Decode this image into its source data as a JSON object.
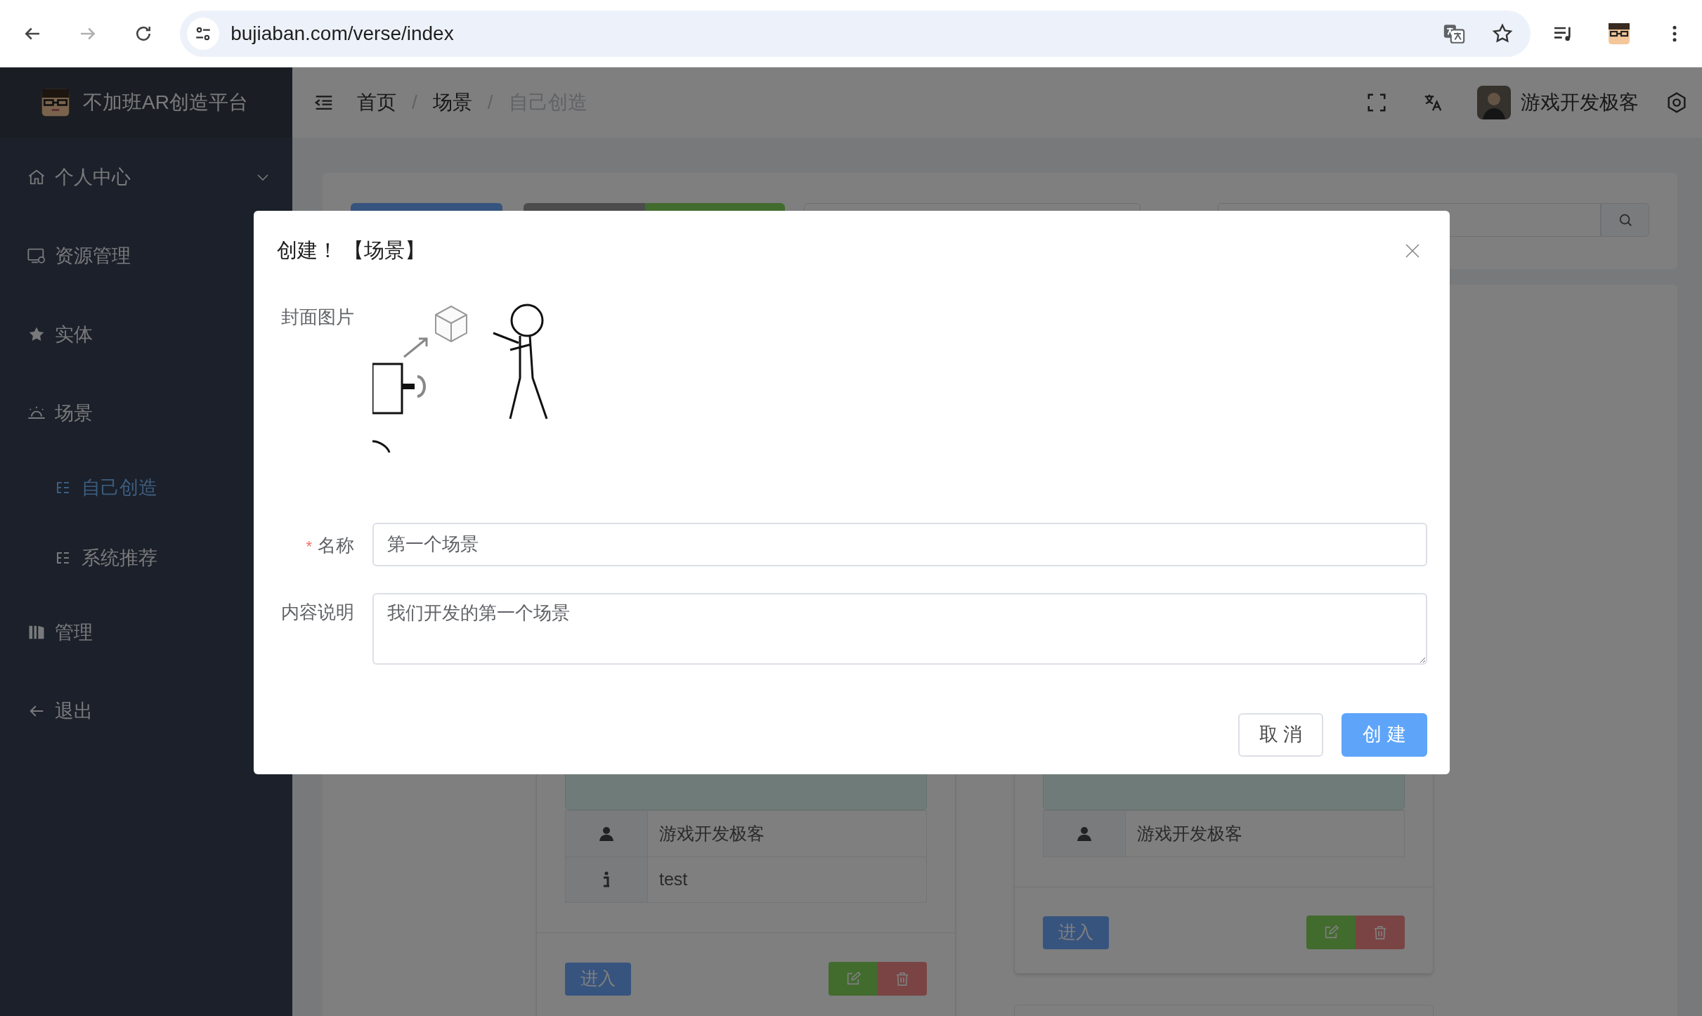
{
  "browser": {
    "url": "bujiaban.com/verse/index",
    "back_disabled": false,
    "forward_disabled": true
  },
  "sidebar": {
    "title": "不加班AR创造平台",
    "items": [
      {
        "label": "个人中心",
        "selected": false,
        "expanded": false
      },
      {
        "label": "资源管理",
        "selected": false
      },
      {
        "label": "实体",
        "selected": false
      },
      {
        "label": "场景",
        "selected": false,
        "expanded": true,
        "children": [
          {
            "label": "自己创造",
            "selected": true
          },
          {
            "label": "系统推荐",
            "selected": false
          }
        ]
      },
      {
        "label": "管理",
        "selected": false
      },
      {
        "label": "退出",
        "selected": false
      }
    ]
  },
  "header": {
    "breadcrumb": [
      {
        "label": "首页",
        "current": false
      },
      {
        "label": "场景",
        "current": false
      },
      {
        "label": "自己创造",
        "current": true
      }
    ],
    "separator": "/",
    "user": "游戏开发极客"
  },
  "cards": [
    {
      "rows": [
        {
          "kind": "author",
          "text": "游戏开发极客"
        },
        {
          "kind": "info",
          "text": "test"
        }
      ],
      "enter": "进入"
    },
    {
      "rows": [
        {
          "kind": "author",
          "text": "游戏开发极客"
        }
      ],
      "enter": "进入"
    }
  ],
  "dialog": {
    "title": "创建！ 【场景】",
    "cover_label": "封面图片",
    "fields": [
      {
        "kind": "input",
        "label": "名称",
        "required_mark": "*",
        "value": "第一个场景"
      },
      {
        "kind": "textarea",
        "label": "内容说明",
        "value": "我们开发的第一个场景"
      }
    ],
    "buttons": [
      {
        "kind": "default",
        "label": "取 消"
      },
      {
        "kind": "primary",
        "label": "创 建"
      }
    ]
  }
}
